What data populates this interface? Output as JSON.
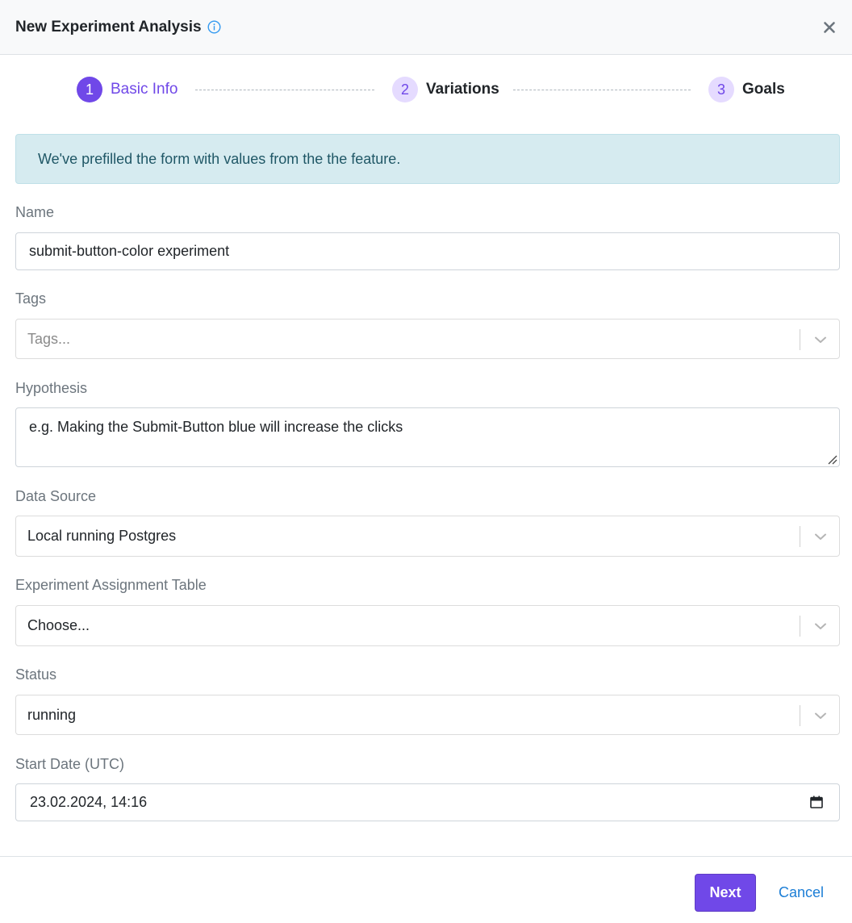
{
  "header": {
    "title": "New Experiment Analysis"
  },
  "stepper": {
    "steps": [
      {
        "number": "1",
        "label": "Basic Info"
      },
      {
        "number": "2",
        "label": "Variations"
      },
      {
        "number": "3",
        "label": "Goals"
      }
    ]
  },
  "alert": {
    "text": "We've prefilled the form with values from the the feature."
  },
  "form": {
    "name": {
      "label": "Name",
      "value": "submit-button-color experiment"
    },
    "tags": {
      "label": "Tags",
      "placeholder": "Tags..."
    },
    "hypothesis": {
      "label": "Hypothesis",
      "placeholder": "e.g. Making the Submit-Button blue will increase the clicks"
    },
    "data_source": {
      "label": "Data Source",
      "value": "Local running Postgres"
    },
    "assignment_table": {
      "label": "Experiment Assignment Table",
      "value": "Choose..."
    },
    "status": {
      "label": "Status",
      "value": "running"
    },
    "start_date": {
      "label": "Start Date (UTC)",
      "value": "23.02.2024, 14:16"
    }
  },
  "footer": {
    "next_label": "Next",
    "cancel_label": "Cancel"
  },
  "colors": {
    "accent": "#7048e8",
    "accent_light": "#e5dbff",
    "info_bg": "#d6ebf0",
    "link": "#1c7ed6"
  },
  "icons": {
    "info": "info-icon",
    "close": "close-icon",
    "chevron": "chevron-down-icon",
    "calendar": "calendar-icon"
  }
}
